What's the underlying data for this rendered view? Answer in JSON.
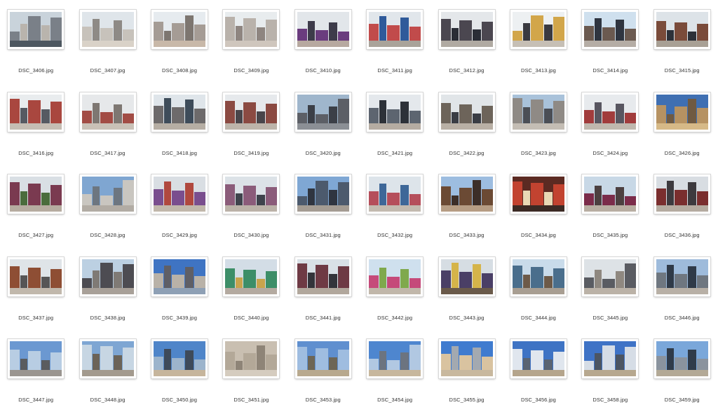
{
  "files": [
    {
      "name": "DSC_3406.jpg",
      "palette": [
        "#c9d3db",
        "#7a8088",
        "#b9b4ad",
        "#4d5760"
      ]
    },
    {
      "name": "DSC_3407.jpg",
      "palette": [
        "#dfe5ea",
        "#c7c2bb",
        "#8e8a86",
        "#d9d2c8"
      ]
    },
    {
      "name": "DSC_3408.jpg",
      "palette": [
        "#e6ebef",
        "#a59c95",
        "#7d7670",
        "#c8b8a8"
      ]
    },
    {
      "name": "DSC_3409.jpg",
      "palette": [
        "#e8ecee",
        "#b9b2ab",
        "#8e8580",
        "#cfc6bd"
      ]
    },
    {
      "name": "DSC_3410.jpg",
      "palette": [
        "#e2e6ea",
        "#6a3c7e",
        "#3d3b4a",
        "#b7a9a0"
      ]
    },
    {
      "name": "DSC_3411.jpg",
      "palette": [
        "#e1e6eb",
        "#c14b4b",
        "#2f5a9a",
        "#a9a39a"
      ]
    },
    {
      "name": "DSC_3412.jpg",
      "palette": [
        "#e4e7ea",
        "#4b4750",
        "#2a2d36",
        "#b0aaa2"
      ]
    },
    {
      "name": "DSC_3413.jpg",
      "palette": [
        "#edf0f2",
        "#d2a64a",
        "#3a3a40",
        "#c6bfb5"
      ]
    },
    {
      "name": "DSC_3414.jpg",
      "palette": [
        "#cfe0ee",
        "#6b5a50",
        "#2f3540",
        "#b5ada5"
      ]
    },
    {
      "name": "DSC_3415.jpg",
      "palette": [
        "#dde3e8",
        "#7a4b3a",
        "#2c3038",
        "#a8a095"
      ]
    },
    {
      "name": "DSC_3416.jpg",
      "palette": [
        "#e9ecee",
        "#a9473f",
        "#565a62",
        "#c5bdb3"
      ]
    },
    {
      "name": "DSC_3417.jpg",
      "palette": [
        "#e6e8ea",
        "#a24c45",
        "#7e7772",
        "#c9c1b7"
      ]
    },
    {
      "name": "DSC_3418.jpg",
      "palette": [
        "#dfe5ea",
        "#6d6a6b",
        "#3e4c5a",
        "#b6aea4"
      ]
    },
    {
      "name": "DSC_3419.jpg",
      "palette": [
        "#e6e9ec",
        "#8b4a42",
        "#49454a",
        "#bdb4aa"
      ]
    },
    {
      "name": "DSC_3420.jpg",
      "palette": [
        "#9fb6cc",
        "#5c5f66",
        "#3b3f47",
        "#8b8f95"
      ]
    },
    {
      "name": "DSC_3421.jpg",
      "palette": [
        "#e4e8ec",
        "#5d6570",
        "#2d3138",
        "#b5aca2"
      ]
    },
    {
      "name": "DSC_3422.jpg",
      "palette": [
        "#e1e5e8",
        "#6d645a",
        "#3a3d44",
        "#b9b0a5"
      ]
    },
    {
      "name": "DSC_3423.jpg",
      "palette": [
        "#a9c2da",
        "#8f8a85",
        "#4b4e55",
        "#c4bdb4"
      ]
    },
    {
      "name": "DSC_3424.jpg",
      "palette": [
        "#e7eaed",
        "#a13c3c",
        "#585660",
        "#c0b8ae"
      ]
    },
    {
      "name": "DSC_3426.jpg",
      "palette": [
        "#3f6fb2",
        "#b69262",
        "#6f5a42",
        "#d6b987"
      ]
    },
    {
      "name": "DSC_3427.jpg",
      "palette": [
        "#d9dfe4",
        "#7a3a50",
        "#4a6c3c",
        "#b6aca0"
      ]
    },
    {
      "name": "DSC_3428.jpg",
      "palette": [
        "#7fa6d1",
        "#c9c6c0",
        "#6d7680",
        "#b2aca4"
      ]
    },
    {
      "name": "DSC_3429.jpg",
      "palette": [
        "#d9dee3",
        "#7a4e8e",
        "#b0483e",
        "#c1b7ab"
      ]
    },
    {
      "name": "DSC_3430.jpg",
      "palette": [
        "#dce2e7",
        "#8b5c7a",
        "#3f434c",
        "#bbb2a8"
      ]
    },
    {
      "name": "DSC_3431.jpg",
      "palette": [
        "#7fa7d4",
        "#4c5a6d",
        "#2f3540",
        "#a49c93"
      ]
    },
    {
      "name": "DSC_3432.jpg",
      "palette": [
        "#dde4ea",
        "#b54e5b",
        "#3e6798",
        "#c3bab0"
      ]
    },
    {
      "name": "DSC_3433.jpg",
      "palette": [
        "#9dbde0",
        "#6b4a34",
        "#3c2e28",
        "#b69d84"
      ]
    },
    {
      "name": "DSC_3434.jpg",
      "palette": [
        "#5b2a22",
        "#c24330",
        "#e9d9b5",
        "#3b2a24"
      ]
    },
    {
      "name": "DSC_3435.jpg",
      "palette": [
        "#c8d8e6",
        "#7b2c4a",
        "#4c4040",
        "#b8aea2"
      ]
    },
    {
      "name": "DSC_3436.jpg",
      "palette": [
        "#d8dde2",
        "#7a2e2e",
        "#3d3a3e",
        "#b5aba0"
      ]
    },
    {
      "name": "DSC_3437.jpg",
      "palette": [
        "#dfe4e8",
        "#8e4e34",
        "#565556",
        "#c1b8ac"
      ]
    },
    {
      "name": "DSC_3438.jpg",
      "palette": [
        "#bcd0e2",
        "#4d4c52",
        "#7f7a75",
        "#a8a098"
      ]
    },
    {
      "name": "DSC_3439.jpg",
      "palette": [
        "#3f74c3",
        "#b9b2a8",
        "#5f5f66",
        "#8ea0b5"
      ]
    },
    {
      "name": "DSC_3440.jpg",
      "palette": [
        "#d3dde6",
        "#3d8e68",
        "#c8a44d",
        "#b4aaa0"
      ]
    },
    {
      "name": "DSC_3441.jpg",
      "palette": [
        "#d9e0e6",
        "#6e3a44",
        "#33343a",
        "#b1a79c"
      ]
    },
    {
      "name": "DSC_3442.jpg",
      "palette": [
        "#cfe0ee",
        "#c54a7a",
        "#7fa94d",
        "#c1b7aa"
      ]
    },
    {
      "name": "DSC_3443.jpg",
      "palette": [
        "#d6dde3",
        "#4a3f66",
        "#d5b44a",
        "#6a5a4a"
      ]
    },
    {
      "name": "DSC_3444.jpg",
      "palette": [
        "#c9dbea",
        "#4a6e8c",
        "#6d5a48",
        "#a89e92"
      ]
    },
    {
      "name": "DSC_3445.jpg",
      "palette": [
        "#dde2e6",
        "#5a5c62",
        "#8f8880",
        "#bbb2a7"
      ]
    },
    {
      "name": "DSC_3446.jpg",
      "palette": [
        "#9ebbdb",
        "#6f7780",
        "#2f3a48",
        "#b8b0a6"
      ]
    },
    {
      "name": "DSC_3447.jpg",
      "palette": [
        "#6b98d1",
        "#b8cde3",
        "#5a5c5f",
        "#9a9590"
      ]
    },
    {
      "name": "DSC_3448.jpg",
      "palette": [
        "#7ea6d3",
        "#c7d6e3",
        "#6b6358",
        "#a39a8e"
      ]
    },
    {
      "name": "DSC_3450.jpg",
      "palette": [
        "#4f85c9",
        "#9cb4cc",
        "#3e4a5a",
        "#c6b59c"
      ]
    },
    {
      "name": "DSC_3451.jpg",
      "palette": [
        "#c9bfb1",
        "#b3a898",
        "#8e8477",
        "#d5ccbf"
      ]
    },
    {
      "name": "DSC_3453.jpg",
      "palette": [
        "#5f8fcf",
        "#9fbde0",
        "#6d6656",
        "#b8a98e"
      ]
    },
    {
      "name": "DSC_3454.jpg",
      "palette": [
        "#4e86cf",
        "#b1c8e2",
        "#6c7480",
        "#c7b79d"
      ]
    },
    {
      "name": "DSC_3455.jpg",
      "palette": [
        "#3f7bcf",
        "#d9c3a0",
        "#a3a9b0",
        "#c8b89e"
      ]
    },
    {
      "name": "DSC_3456.jpg",
      "palette": [
        "#3e73c4",
        "#e0e6ee",
        "#5a6472",
        "#b5a58c"
      ]
    },
    {
      "name": "DSC_3458.jpg",
      "palette": [
        "#3f73c6",
        "#d6dde6",
        "#4c5562",
        "#b7a88f"
      ]
    },
    {
      "name": "DSC_3459.jpg",
      "palette": [
        "#7aa7da",
        "#8a939e",
        "#2f3b4a",
        "#b3a996"
      ]
    }
  ]
}
